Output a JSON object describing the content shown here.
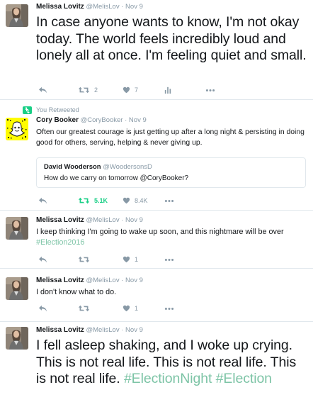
{
  "tweets": [
    {
      "name": "Melissa Lovitz",
      "handle": "@MelisLov",
      "sep": "·",
      "time": "Nov 9",
      "text": "In case anyone wants to know, I'm not okay today. The world feels incredibly loud and lonely all at once. I'm feeling quiet and small.",
      "retweets": "2",
      "likes": "7"
    },
    {
      "context": "You Retweeted",
      "name": "Cory Booker",
      "handle": "@CoryBooker",
      "sep": "·",
      "time": "Nov 9",
      "text": "Often our greatest courage is just getting up after a long night & persisting in doing good for others, serving, helping & never giving up.",
      "quote": {
        "name": "David Wooderson",
        "handle": "@WoodersonsD",
        "text": "How do we carry on tomorrow @CoryBooker?"
      },
      "retweets": "5.1K",
      "likes": "8.4K"
    },
    {
      "name": "Melissa Lovitz",
      "handle": "@MelisLov",
      "sep": "·",
      "time": "Nov 9",
      "text": "I keep thinking I'm going to wake up soon, and this nightmare will be over",
      "hashtag": "#Election2016",
      "retweets": "",
      "likes": "1"
    },
    {
      "name": "Melissa Lovitz",
      "handle": "@MelisLov",
      "sep": "·",
      "time": "Nov 9",
      "text": "I don't know what to do.",
      "retweets": "",
      "likes": "1"
    },
    {
      "name": "Melissa Lovitz",
      "handle": "@MelisLov",
      "sep": "·",
      "time": "Nov 9",
      "text": "I fell asleep shaking, and I woke up crying. This is not real life. This is not real life. This is not real life.",
      "hashtag1": "#ElectionNight",
      "hashtag2": "#Election"
    }
  ],
  "colors": {
    "accent_green": "#19cf86",
    "hashtag": "#7dc4a6",
    "secondary_text": "#8899a6",
    "divider": "#e1e8ed"
  },
  "icons": [
    "reply-icon",
    "retweet-icon",
    "like-icon",
    "analytics-icon",
    "more-icon",
    "snapchat-logo"
  ]
}
